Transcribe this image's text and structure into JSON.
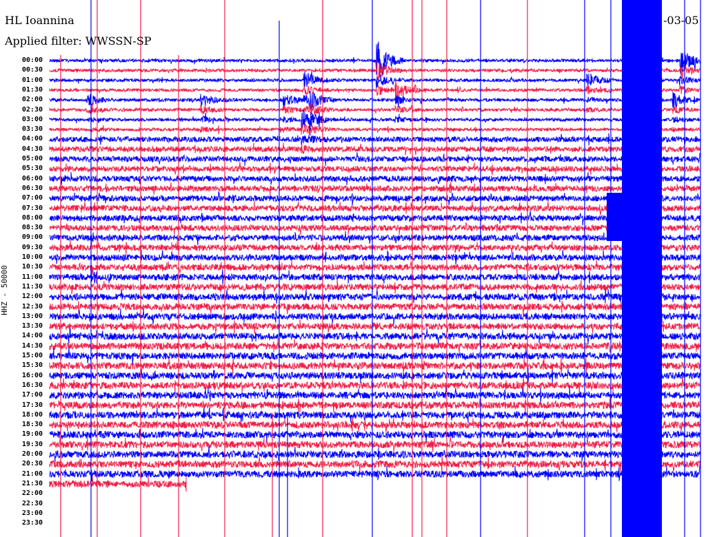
{
  "chart_data": {
    "type": "line",
    "title": "HL Ioannina",
    "subtitle": "Applied filter: WWSSN-SP",
    "date_text": "-03-05",
    "ylabel": "HHZ - 50000",
    "x_units": "minutes within each 30-minute row",
    "xlim": [
      0,
      30
    ],
    "grid": false,
    "colors": {
      "even_rows": "#0000ff",
      "odd_rows": "#f0204a"
    },
    "row_labels": [
      "00:00",
      "00:30",
      "01:00",
      "01:30",
      "02:00",
      "02:30",
      "03:00",
      "03:30",
      "04:00",
      "04:30",
      "05:00",
      "05:30",
      "06:00",
      "06:30",
      "07:00",
      "07:30",
      "08:00",
      "08:30",
      "09:00",
      "09:30",
      "10:00",
      "10:30",
      "11:00",
      "11:30",
      "12:00",
      "12:30",
      "13:00",
      "13:30",
      "14:00",
      "14:30",
      "15:00",
      "15:30",
      "16:00",
      "16:30",
      "17:00",
      "17:30",
      "18:00",
      "18:30",
      "19:00",
      "19:30",
      "20:00",
      "20:30",
      "21:00",
      "21:30",
      "22:00",
      "22:30",
      "23:00",
      "23:30"
    ],
    "rows_with_data": 44,
    "last_row_fraction_recorded": 0.21
  }
}
